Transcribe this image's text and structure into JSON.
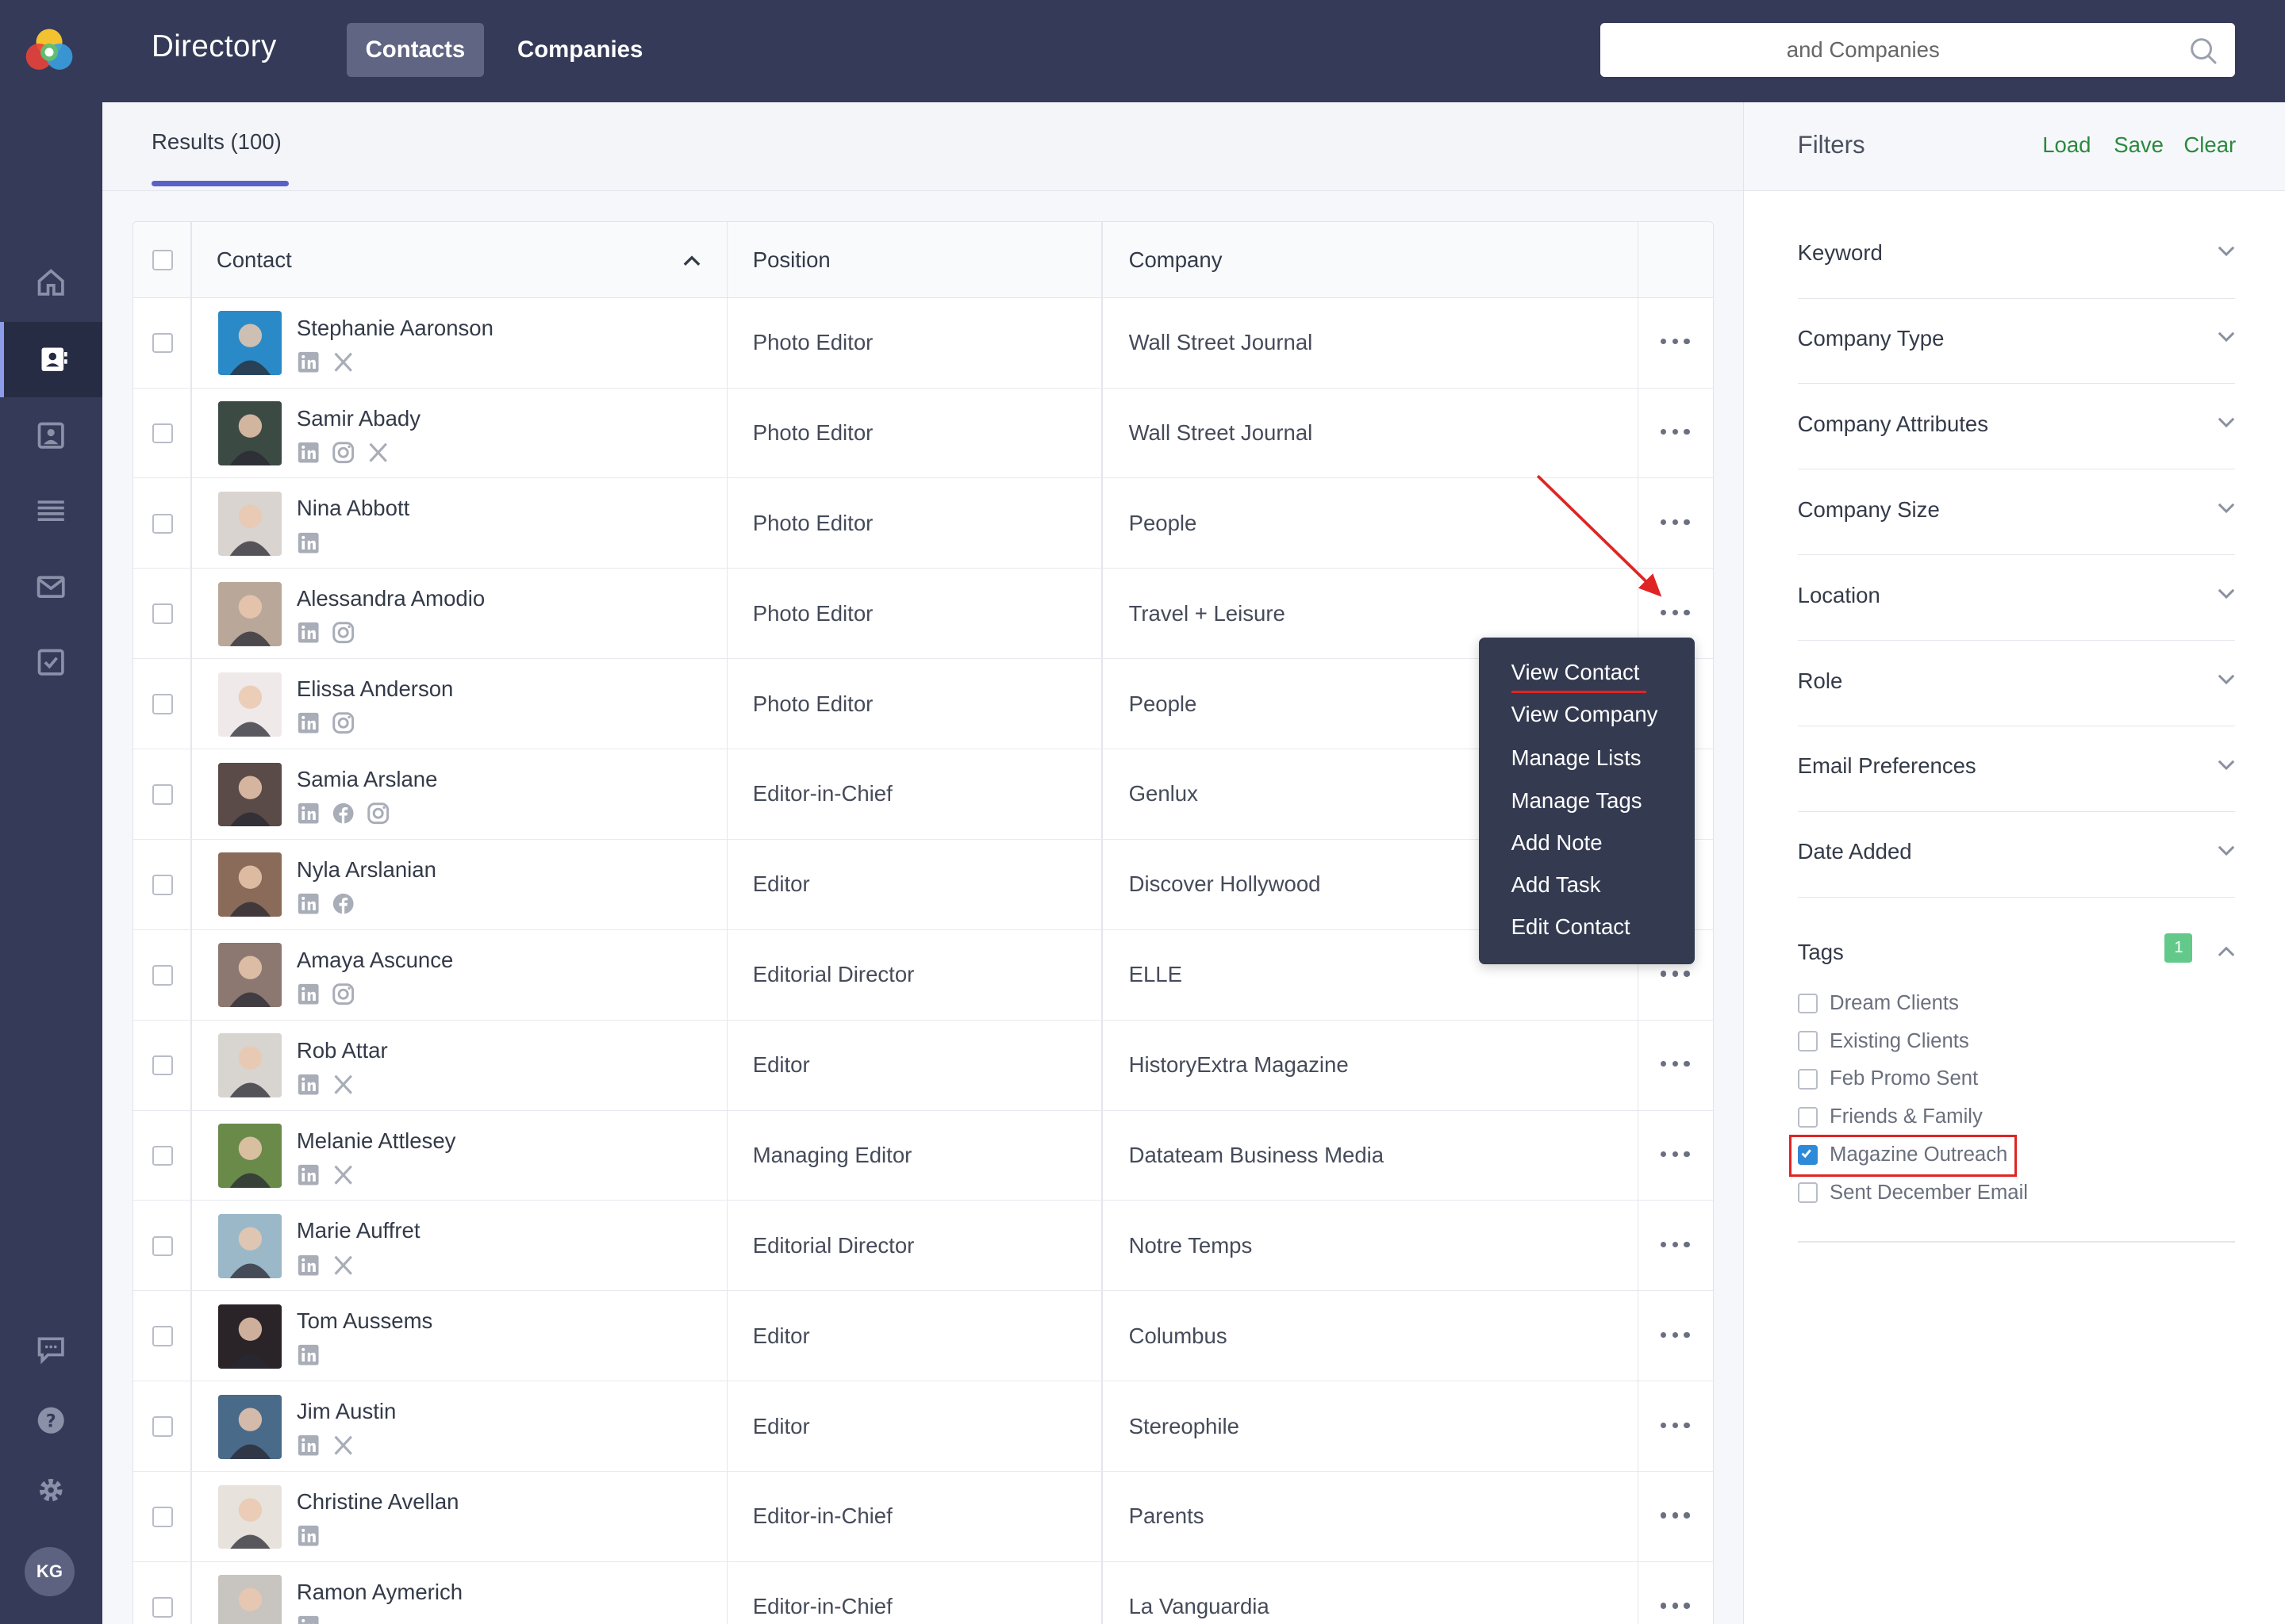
{
  "app": {
    "title": "Directory",
    "nav": {
      "contacts": "Contacts",
      "companies": "Companies"
    },
    "search_placeholder": "and Companies"
  },
  "sidebar": {
    "icons": [
      "home-icon",
      "contacts-icon",
      "profile-icon",
      "list-icon",
      "mail-icon",
      "tasks-icon",
      "feedback-icon",
      "help-icon",
      "settings-icon"
    ],
    "user_initials": "KG"
  },
  "results": {
    "tab_label": "Results (100)"
  },
  "table": {
    "headers": {
      "contact": "Contact",
      "position": "Position",
      "company": "Company"
    },
    "rows": [
      {
        "name": "Stephanie Aaronson",
        "position": "Photo Editor",
        "company": "Wall Street Journal",
        "socials": [
          "linkedin",
          "x"
        ],
        "photo_color": "#2a8ac8"
      },
      {
        "name": "Samir Abady",
        "position": "Photo Editor",
        "company": "Wall Street Journal",
        "socials": [
          "linkedin",
          "instagram",
          "x"
        ],
        "photo_color": "#3c4a44"
      },
      {
        "name": "Nina Abbott",
        "position": "Photo Editor",
        "company": "People",
        "socials": [
          "linkedin"
        ],
        "photo_color": "#d9d4cf"
      },
      {
        "name": "Alessandra Amodio",
        "position": "Photo Editor",
        "company": "Travel + Leisure",
        "socials": [
          "linkedin",
          "instagram"
        ],
        "photo_color": "#b9a899"
      },
      {
        "name": "Elissa Anderson",
        "position": "Photo Editor",
        "company": "People",
        "socials": [
          "linkedin",
          "instagram"
        ],
        "photo_color": "#efe9ea"
      },
      {
        "name": "Samia Arslane",
        "position": "Editor-in-Chief",
        "company": "Genlux",
        "socials": [
          "linkedin",
          "facebook",
          "instagram"
        ],
        "photo_color": "#5a4a48"
      },
      {
        "name": "Nyla Arslanian",
        "position": "Editor",
        "company": "Discover Hollywood",
        "socials": [
          "linkedin",
          "facebook"
        ],
        "photo_color": "#8a6a58"
      },
      {
        "name": "Amaya Ascunce",
        "position": "Editorial Director",
        "company": "ELLE",
        "socials": [
          "linkedin",
          "instagram"
        ],
        "photo_color": "#8c7870"
      },
      {
        "name": "Rob Attar",
        "position": "Editor",
        "company": "HistoryExtra Magazine",
        "socials": [
          "linkedin",
          "x"
        ],
        "photo_color": "#d8d4d0"
      },
      {
        "name": "Melanie Attlesey",
        "position": "Managing Editor",
        "company": "Datateam Business Media",
        "socials": [
          "linkedin",
          "x"
        ],
        "photo_color": "#6a8a4a"
      },
      {
        "name": "Marie Auffret",
        "position": "Editorial Director",
        "company": "Notre Temps",
        "socials": [
          "linkedin",
          "x"
        ],
        "photo_color": "#9ab8c8"
      },
      {
        "name": "Tom Aussems",
        "position": "Editor",
        "company": "Columbus",
        "socials": [
          "linkedin"
        ],
        "photo_color": "#2a2428"
      },
      {
        "name": "Jim Austin",
        "position": "Editor",
        "company": "Stereophile",
        "socials": [
          "linkedin",
          "x"
        ],
        "photo_color": "#4a6a8a"
      },
      {
        "name": "Christine Avellan",
        "position": "Editor-in-Chief",
        "company": "Parents",
        "socials": [
          "linkedin"
        ],
        "photo_color": "#e8e2dc"
      },
      {
        "name": "Ramon Aymerich",
        "position": "Editor-in-Chief",
        "company": "La Vanguardia",
        "socials": [
          "linkedin"
        ],
        "photo_color": "#c8c4c0"
      }
    ]
  },
  "context_menu": {
    "items": [
      "View Contact",
      "View Company",
      "Manage Lists",
      "Manage Tags",
      "Add Note",
      "Add Task",
      "Edit Contact"
    ]
  },
  "filters": {
    "title": "Filters",
    "actions": {
      "load": "Load",
      "save": "Save",
      "clear": "Clear"
    },
    "sections": [
      "Keyword",
      "Company Type",
      "Company Attributes",
      "Company Size",
      "Location",
      "Role",
      "Email Preferences",
      "Date Added"
    ],
    "tags": {
      "label": "Tags",
      "count": "1",
      "options": [
        {
          "label": "Dream Clients",
          "checked": false
        },
        {
          "label": "Existing Clients",
          "checked": false
        },
        {
          "label": "Feb Promo Sent",
          "checked": false
        },
        {
          "label": "Friends & Family",
          "checked": false
        },
        {
          "label": "Magazine Outreach",
          "checked": true
        },
        {
          "label": "Sent December Email",
          "checked": false
        }
      ]
    }
  },
  "colors": {
    "topbar": "#343a58",
    "accent": "#5b60c7",
    "filter_action": "#2a8a3e",
    "annotation": "#e02424"
  }
}
